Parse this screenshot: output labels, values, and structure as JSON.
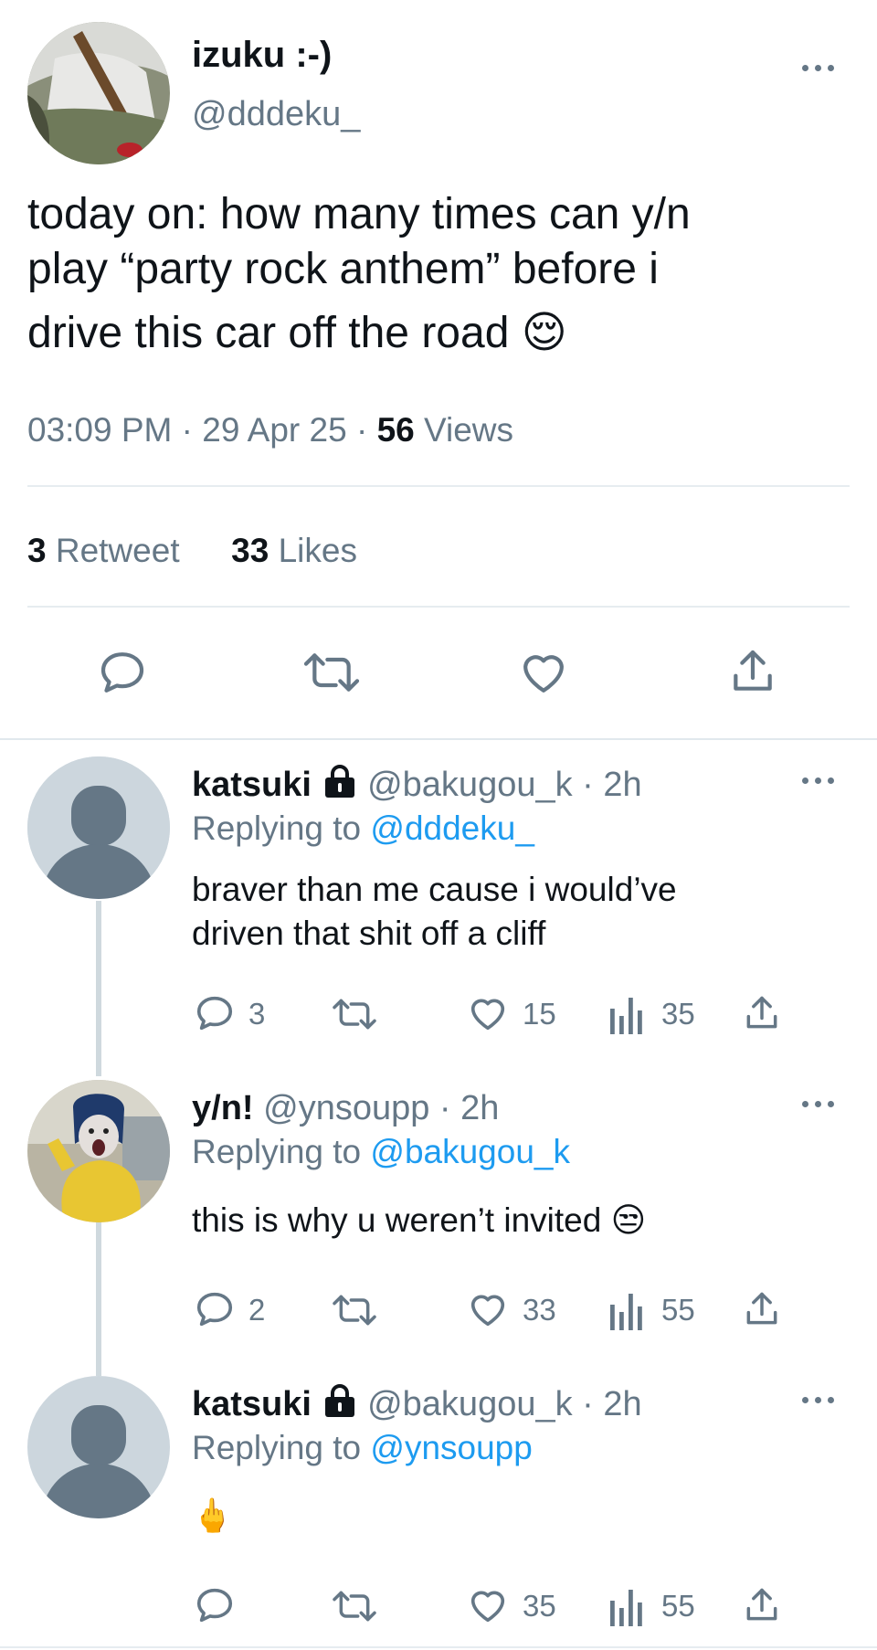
{
  "main_tweet": {
    "display_name": "izuku :-)",
    "handle": "@dddeku_",
    "text_line1": "today on: how many times can y/n",
    "text_line2": "play “party rock anthem” before i",
    "text_line3": "drive this car off the road",
    "text_emoji": "😌",
    "time": "03:09 PM",
    "date": "29 Apr 25",
    "views_count": "56",
    "views_label": "Views",
    "retweet_count": "3",
    "retweet_label": "Retweet",
    "likes_count": "33",
    "likes_label": "Likes"
  },
  "replies": [
    {
      "display_name": "katsuki",
      "handle_time": "@bakugou_k · 2h",
      "replying_label": "Replying to",
      "replying_to": "@dddeku_",
      "text_line1": "braver than me cause i would’ve",
      "text_line2": "driven that shit off a cliff",
      "reply_count": "3",
      "retweet_count": "",
      "like_count": "15",
      "view_count": "35"
    },
    {
      "display_name": "y/n!",
      "handle_time": "@ynsoupp · 2h",
      "replying_label": "Replying to",
      "replying_to": "@bakugou_k",
      "text_line1": "this is why u weren’t invited",
      "text_emoji": "😒",
      "reply_count": "2",
      "retweet_count": "",
      "like_count": "33",
      "view_count": "55"
    },
    {
      "display_name": "katsuki",
      "handle_time": "@bakugou_k · 2h",
      "replying_label": "Replying to",
      "replying_to": "@ynsoupp",
      "text_emoji": "🖕",
      "reply_count": "",
      "retweet_count": "",
      "like_count": "35",
      "view_count": "55"
    }
  ],
  "colors": {
    "text": "#0f1419",
    "muted": "#657786",
    "link": "#1d9bf0",
    "divider": "#e6ecf0"
  }
}
